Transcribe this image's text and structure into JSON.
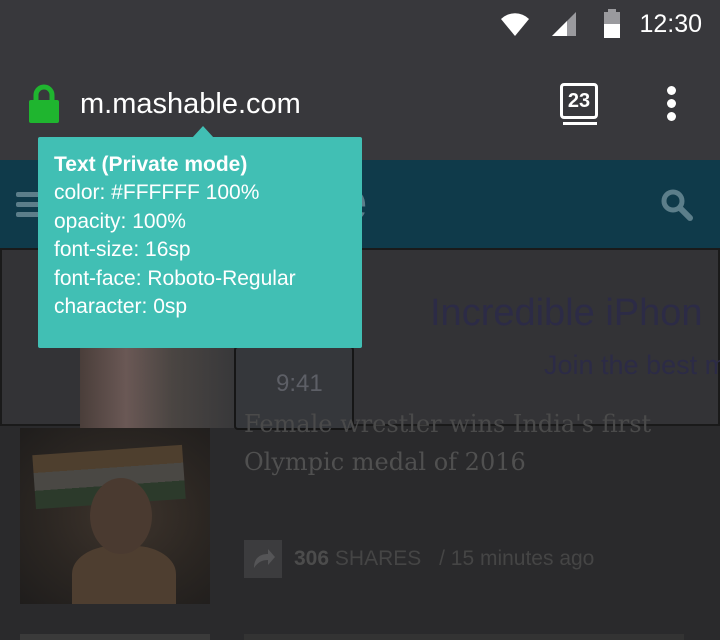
{
  "status_bar": {
    "time": "12:30",
    "icons": [
      "wifi-icon",
      "cell-signal-icon",
      "battery-icon"
    ]
  },
  "toolbar": {
    "url": "m.mashable.com",
    "tab_count": "23",
    "lock_color": "#1fb52f",
    "icons": [
      "lock-icon",
      "tabs-icon",
      "overflow-menu-icon"
    ]
  },
  "tooltip": {
    "title": "Text (Private mode)",
    "lines": [
      "color: #FFFFFF 100%",
      "opacity: 100%",
      "font-size: 16sp",
      "font-face: Roboto-Regular",
      "character: 0sp"
    ],
    "background": "#41bfb4"
  },
  "site": {
    "logo_fragment": "e",
    "icons": [
      "hamburger-menu-icon",
      "search-icon"
    ]
  },
  "ad": {
    "headline": "Incredible iPhon",
    "subline": "Join the best m",
    "phone_time": "9:41"
  },
  "article": {
    "title_line_1": "Female wrestler wins India's first",
    "title_line_2": "Olympic medal of 2016",
    "shares_count": "306",
    "shares_label": "SHARES",
    "time_ago": "/ 15 minutes ago"
  },
  "colors": {
    "chrome": "#38383c",
    "site_header": "#0f3a4a",
    "tooltip_bg": "#41bfb4"
  }
}
